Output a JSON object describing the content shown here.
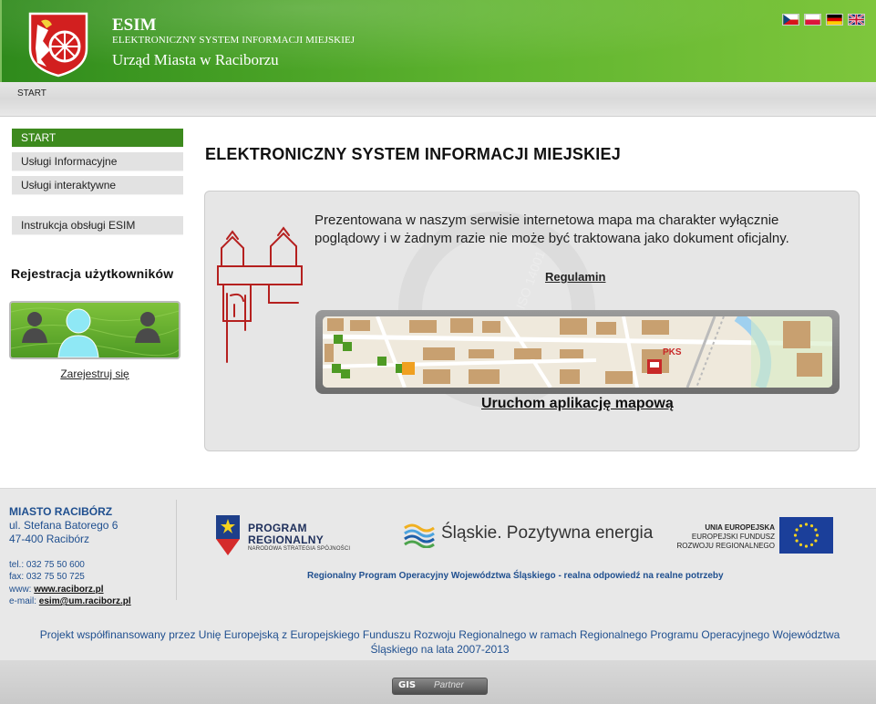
{
  "header": {
    "title": "ESIM",
    "subtitle": "ELEKTRONICZNY SYSTEM INFORMACJI MIEJSKIEJ",
    "office": "Urząd Miasta w Raciborzu",
    "languages": [
      "cz-flag-icon",
      "pl-flag-icon",
      "de-flag-icon",
      "gb-flag-icon"
    ]
  },
  "breadcrumb": "START",
  "nav": {
    "items": [
      {
        "label": "START",
        "active": true
      },
      {
        "label": "Usługi Informacyjne"
      },
      {
        "label": "Usługi interaktywne"
      },
      {
        "label": "Instrukcja obsługi ESIM"
      }
    ]
  },
  "registration": {
    "title": "Rejestracja użytkowników",
    "link": "Zarejestruj się"
  },
  "main": {
    "title": "ELEKTRONICZNY SYSTEM INFORMACJI MIEJSKIEJ",
    "disclaimer": "Prezentowana w naszym serwisie internetowa mapa ma charakter wyłącznie poglądowy i w żadnym razie nie może być traktowana jako dokument oficjalny.",
    "regulamin": "Regulamin",
    "map_link": "Uruchom aplikację mapową",
    "map_label": "PKS",
    "watermark": "ISO 14001"
  },
  "footer": {
    "city": "MIASTO RACIBÓRZ",
    "street": "ul. Stefana Batorego 6",
    "postal": "47-400 Racibórz",
    "tel": "tel.: 032 75 50 600",
    "fax": "fax: 032 75 50 725",
    "www_label": "www: ",
    "www": "www.raciborz.pl",
    "mail_label": "e-mail: ",
    "mail": "esim@um.raciborz.pl",
    "program_line1": "PROGRAM",
    "program_line2": "REGIONALNY",
    "program_line3": "NARODOWA STRATEGIA SPÓJNOŚCI",
    "slaskie": "Śląskie. Pozytywna energia",
    "eu_line1": "UNIA EUROPEJSKA",
    "eu_line2": "EUROPEJSKI FUNDUSZ",
    "eu_line3": "ROZWOJU REGIONALNEGO",
    "rpo_slogan": "Regionalny Program Operacyjny Województwa Śląskiego - realna odpowiedź na realne potrzeby",
    "cofund": "Projekt współfinansowany przez Unię Europejską z Europejskiego Funduszu Rozwoju Regionalnego w ramach Regionalnego Programu Operacyjnego Województwa Śląskiego na lata 2007-2013"
  },
  "bottom": {
    "gis": "GIS",
    "partner": "Partner"
  },
  "colors": {
    "brand_green": "#3d8a1e",
    "footer_blue": "#1f4f8f"
  }
}
